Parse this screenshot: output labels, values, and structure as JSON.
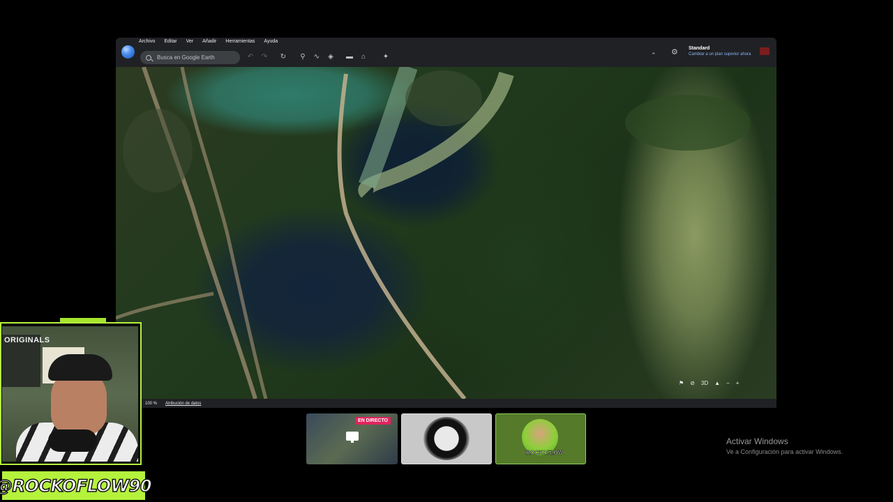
{
  "app": {
    "menu": [
      "Archivo",
      "Editar",
      "Ver",
      "Añadir",
      "Herramientas",
      "Ayuda"
    ],
    "search_placeholder": "Busca en Google Earth",
    "plan": {
      "title": "Standard",
      "subtitle": "Cambiar a un plan superior ahora"
    },
    "toolbar_icons": [
      "undo-icon",
      "redo-icon",
      "history-icon",
      "placemark-icon",
      "path-icon",
      "layers-icon",
      "ruler-icon",
      "projects-icon",
      "satellite-icon"
    ]
  },
  "map": {
    "controls": {
      "mode_3d": "3D"
    },
    "status": {
      "zoom": "100 %",
      "attribution": "Atribución de datos"
    }
  },
  "stream": {
    "handle": "@ROCKOFLOW90",
    "cam_poster": "ORIGINALS",
    "tiles": [
      {
        "badge": "EN DIRECTO"
      },
      {
        "badge": ""
      },
      {
        "label": "ROCKOFLOW"
      }
    ]
  },
  "watermark": {
    "title": "Activar Windows",
    "subtitle": "Ve a Configuración para activar Windows."
  },
  "colors": {
    "accent": "#b4f23c",
    "live": "#e0245e",
    "link": "#8ab4f8"
  }
}
